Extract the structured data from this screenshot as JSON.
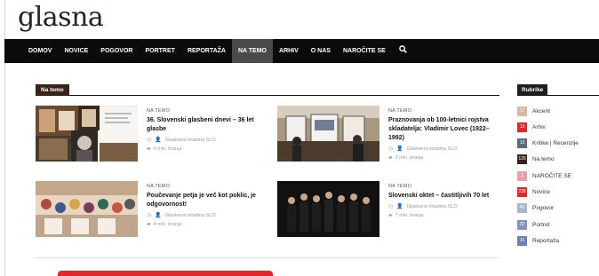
{
  "logo": "glasna",
  "nav": {
    "items": [
      "DOMOV",
      "NOVICE",
      "POGOVOR",
      "PORTRET",
      "REPORTAŽA",
      "NA TEMO",
      "ARHIV",
      "O NAS",
      "NAROČITE SE"
    ],
    "active_index": 5,
    "search_icon": "search-icon"
  },
  "section": {
    "title": "Na temo"
  },
  "articles": [
    {
      "category": "NA TEMO",
      "title": "36. Slovenski glasbeni dnevi – 36 let glasbe",
      "author": "Glasbena mladina SLO",
      "read_time": "4 min. branja"
    },
    {
      "category": "NA TEMO",
      "title": "Praznovanja ob 100-letnici rojstva skladatelja: Vladimir Lovec (1922–1992)",
      "author": "Glasbena mladina SLO",
      "read_time": "3 min. branja"
    },
    {
      "category": "NA TEMO",
      "title": "Poučevanje petja je več kot poklic, je odgovornost!",
      "author": "Glasbena mladina SLO",
      "read_time": "4 min. branja"
    },
    {
      "category": "NA TEMO",
      "title": "Slovenski oktet – častitljivih 70 let",
      "author": "Glasbena mladina SLO",
      "read_time": "7 min. branja"
    }
  ],
  "sidebar": {
    "title": "Rubrike",
    "items": [
      {
        "count": "17",
        "label": "Akcent",
        "color": "#d9b8a2"
      },
      {
        "count": "13",
        "label": "Arhiv",
        "color": "#e02727"
      },
      {
        "count": "13",
        "label": "Kritike | Recenzije",
        "color": "#5b6b78"
      },
      {
        "count": "126",
        "label": "Na temo",
        "color": "#3a2418"
      },
      {
        "count": "1",
        "label": "NAROČITE SE",
        "color": "#e9a0a8"
      },
      {
        "count": "239",
        "label": "Novice",
        "color": "#e02727"
      },
      {
        "count": "40",
        "label": "Pogovor",
        "color": "#a9b4cf"
      },
      {
        "count": "32",
        "label": "Portret",
        "color": "#8393c0"
      },
      {
        "count": "15",
        "label": "Reportaža",
        "color": "#6b7fb5"
      }
    ]
  }
}
